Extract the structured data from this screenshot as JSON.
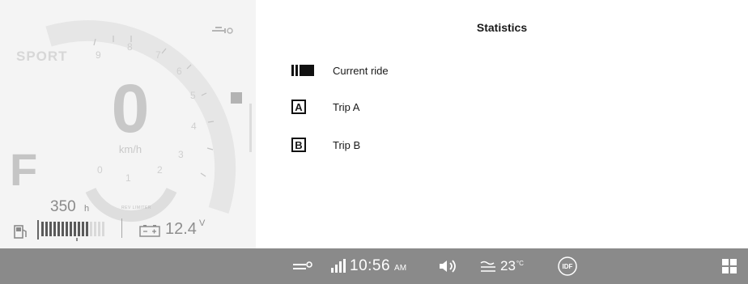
{
  "dashboard": {
    "mode": "SPORT",
    "speed": "0",
    "speed_unit": "km/h",
    "gear": "F",
    "range_value": "350",
    "range_unit": "h",
    "rpm_ticks": [
      "0",
      "1",
      "2",
      "3",
      "4",
      "5",
      "6",
      "7",
      "8",
      "9"
    ],
    "tiny_label": "REV LIMITER",
    "voltage_value": "12.4",
    "voltage_unit": "V",
    "fuel_level_fraction": 0.75,
    "icons": {
      "top_right": "wrench-gauge-icon",
      "fuel": "fuel-pump-icon",
      "battery": "battery-icon"
    }
  },
  "statistics": {
    "title": "Statistics",
    "items": [
      {
        "label": "Current ride",
        "icon": "current-ride-icon"
      },
      {
        "label": "Trip A",
        "icon_text": "A"
      },
      {
        "label": "Trip B",
        "icon_text": "B"
      }
    ]
  },
  "statusbar": {
    "time": "10:56",
    "ampm": "AM",
    "temperature": "23",
    "temp_unit": "°C",
    "logo_text": "IDF",
    "icons": {
      "left": "wrench-connect-icon",
      "signal": "signal-bars-icon",
      "volume": "volume-icon",
      "weather": "fog-icon",
      "apps": "apps-grid-icon"
    },
    "bg_color": "#8a8a8a"
  }
}
